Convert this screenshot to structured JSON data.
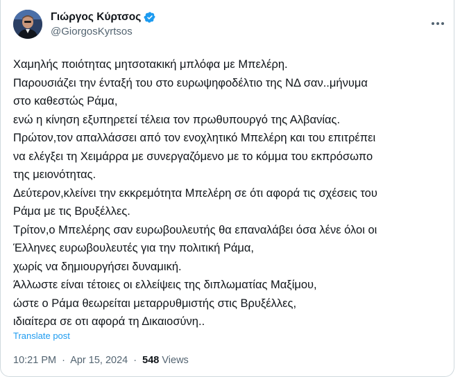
{
  "author": {
    "name": "Γιώργος Κύρτσος",
    "handle": "@GiorgosKyrtsos",
    "verified": true
  },
  "tweet": {
    "lines": [
      "Χαμηλής ποιότητας μητσοτακική μπλόφα με Μπελέρη.",
      "Παρουσιάζει την ένταξή του στο ευρωψηφοδέλτιο της ΝΔ σαν..μήνυμα",
      "στο καθεστώς Ράμα,",
      "ενώ η κίνηση εξυπηρετεί τέλεια τον πρωθυπουργό της Αλβανίας.",
      "Πρώτον,τον απαλλάσσει από τον ενοχλητικό Μπελέρη και του επιτρέπει",
      "να ελέγξει τη Χειμάρρα με συνεργαζόμενο με το κόμμα του εκπρόσωπο",
      "της μειονότητας.",
      "Δεύτερον,κλείνει την εκκρεμότητα Μπελέρη σε ότι αφορά τις σχέσεις του",
      "Ράμα με τις Βρυξέλλες.",
      "Τρίτον,ο Μπελέρης σαν ευρωβουλευτής θα επαναλάβει όσα λένε όλοι οι",
      "Έλληνες ευρωβουλευτές για την πολιτική Ράμα,",
      "χωρίς να δημιουργήσει δυναμική.",
      "Άλλωστε είναι τέτοιες οι ελλείψεις της διπλωματίας Μαξίμου,",
      "ώστε ο Ράμα θεωρείται μεταρρυθμιστής στις Βρυξέλλες,",
      "ιδιαίτερα σε οτι αφορά τη Δικαιοσύνη.."
    ],
    "translate_label": "Translate post"
  },
  "meta": {
    "time": "10:21 PM",
    "date": "Apr 15, 2024",
    "separator": "·",
    "views_count": "548",
    "views_label": "Views"
  },
  "colors": {
    "text": "#0f1419",
    "secondary": "#536471",
    "accent": "#1d9bf0",
    "border": "#cfd9de"
  },
  "icons": {
    "verified": "verified-badge-icon",
    "more": "more-options-icon"
  }
}
